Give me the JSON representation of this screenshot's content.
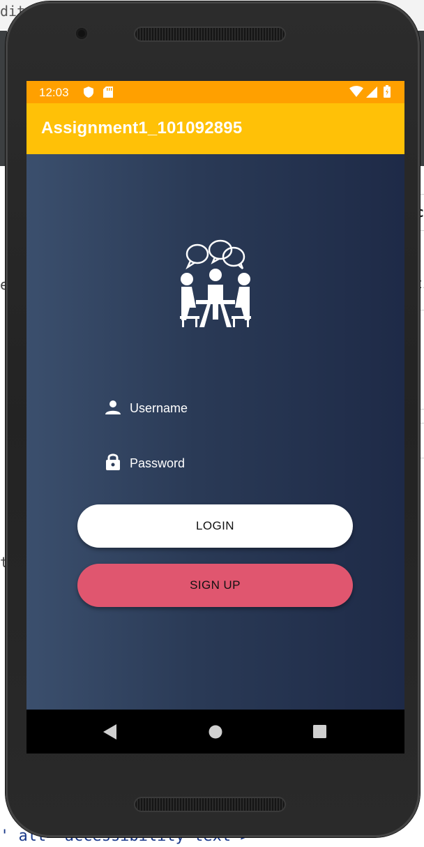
{
  "background": {
    "frag_top": "dit/",
    "frag_right_1": "c",
    "frag_left": "e",
    "frag_right_2": "ti",
    "frag_left_2": "t",
    "code_line": "' alt= accessibility text >"
  },
  "status_bar": {
    "time": "12:03",
    "color": "#ffa000"
  },
  "app_bar": {
    "title": "Assignment1_101092895",
    "color": "#ffc107"
  },
  "login_form": {
    "logo_icon": "meeting-people-chat-icon",
    "username": {
      "icon": "person-icon",
      "placeholder": "Username"
    },
    "password": {
      "icon": "lock-icon",
      "placeholder": "Password"
    },
    "login_label": "LOGIN",
    "signup_label": "SIGN UP",
    "signup_color": "#e0566f"
  },
  "nav_bar": {
    "back": "back-icon",
    "home": "home-icon",
    "recents": "recents-icon"
  }
}
